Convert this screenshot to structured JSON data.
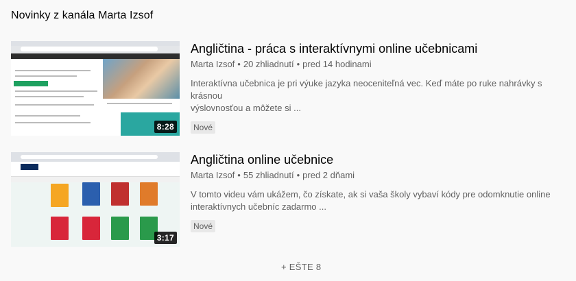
{
  "section": {
    "title": "Novinky z kanála Marta Izsof"
  },
  "videos": [
    {
      "title": "Angličtina - práca s interaktívnymi online učebnicami",
      "channel": "Marta Izsof",
      "views": "20 zhliadnutí",
      "age": "pred 14 hodinami",
      "description_line1": "Interaktívna učebnica je pri výuke jazyka neoceniteľná vec. Keď máte po ruke nahrávky s krásnou",
      "description_line2": "výslovnosťou a môžete si ...",
      "badge": "Nové",
      "duration": "8:28"
    },
    {
      "title": "Angličtina online učebnice",
      "channel": "Marta Izsof",
      "views": "55 zhliadnutí",
      "age": "pred 2 dňami",
      "description_line1": "V tomto videu vám ukážem, čo získate, ak si vaša školy vybaví kódy pre odomknutie online",
      "description_line2": "interaktívnych učebníc zadarmo ...",
      "badge": "Nové",
      "duration": "3:17"
    }
  ],
  "more": {
    "label": "+ EŠTE 8"
  },
  "colors": {
    "background": "#f9f9f9",
    "secondary_text": "#606060",
    "duration_bg": "#000000",
    "badge_bg": "#e8e8e8"
  }
}
